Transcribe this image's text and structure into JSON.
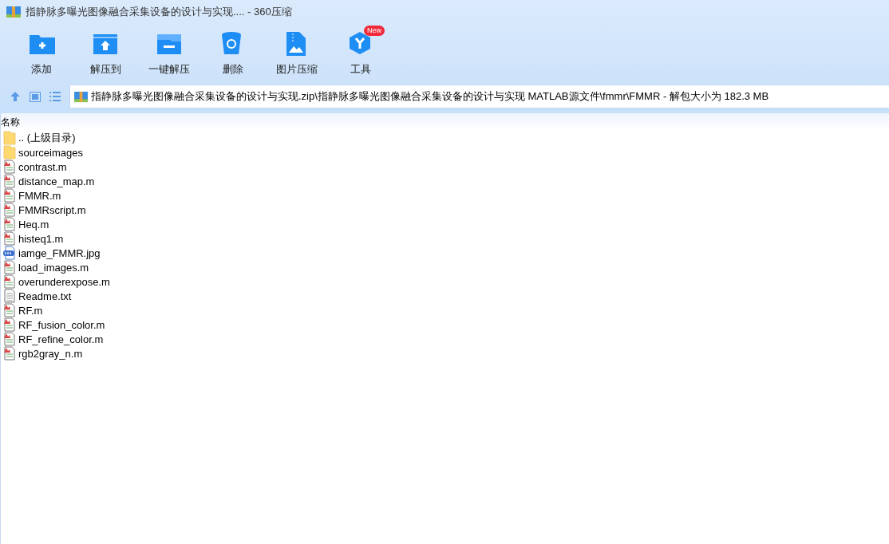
{
  "window": {
    "title": "指静脉多曝光图像融合采集设备的设计与实现.... - 360压缩"
  },
  "toolbar": [
    {
      "kind": "add",
      "label": "添加"
    },
    {
      "kind": "extract",
      "label": "解压到"
    },
    {
      "kind": "oneclick",
      "label": "一键解压"
    },
    {
      "kind": "delete",
      "label": "删除"
    },
    {
      "kind": "image",
      "label": "图片压缩"
    },
    {
      "kind": "tools",
      "label": "工具",
      "badge": "New"
    }
  ],
  "address": {
    "path": "指静脉多曝光图像融合采集设备的设计与实现.zip\\指静脉多曝光图像融合采集设备的设计与实现 MATLAB源文件\\fmmr\\FMMR - 解包大小为 182.3 MB"
  },
  "table": {
    "columns": [
      "名称"
    ],
    "rows": [
      {
        "kind": "folder",
        "name": ".. (上级目录)"
      },
      {
        "kind": "folder",
        "name": "sourceimages"
      },
      {
        "kind": "m",
        "name": "contrast.m"
      },
      {
        "kind": "m",
        "name": "distance_map.m"
      },
      {
        "kind": "m",
        "name": "FMMR.m"
      },
      {
        "kind": "m",
        "name": "FMMRscript.m"
      },
      {
        "kind": "m",
        "name": "Heq.m"
      },
      {
        "kind": "m",
        "name": "histeq1.m"
      },
      {
        "kind": "jpg",
        "name": "iamge_FMMR.jpg"
      },
      {
        "kind": "m",
        "name": "load_images.m"
      },
      {
        "kind": "m",
        "name": "overunderexpose.m"
      },
      {
        "kind": "txt",
        "name": "Readme.txt"
      },
      {
        "kind": "m",
        "name": "RF.m"
      },
      {
        "kind": "m",
        "name": "RF_fusion_color.m"
      },
      {
        "kind": "m",
        "name": "RF_refine_color.m"
      },
      {
        "kind": "m",
        "name": "rgb2gray_n.m"
      }
    ]
  }
}
